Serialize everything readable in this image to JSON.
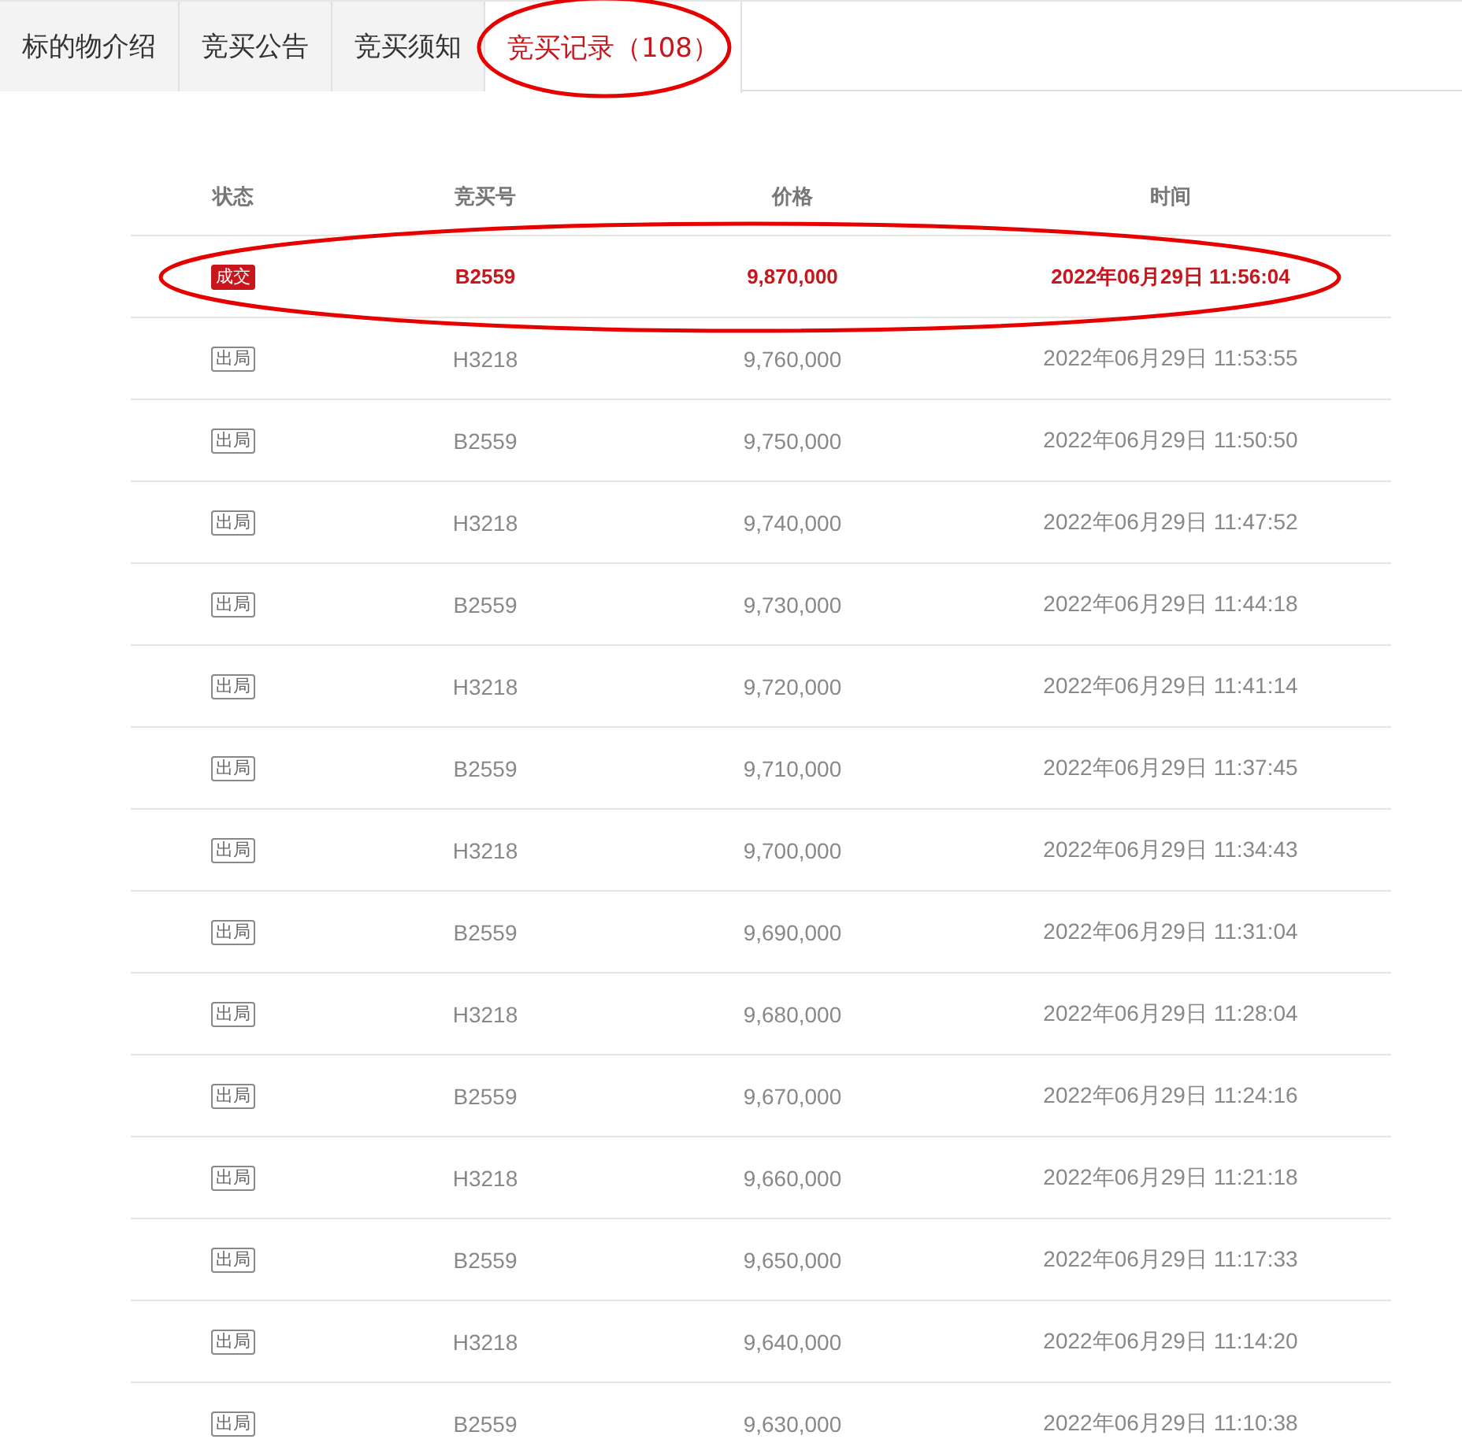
{
  "tabs": [
    {
      "label": "标的物介绍",
      "selected": false,
      "circled": false
    },
    {
      "label": "竞买公告",
      "selected": false,
      "circled": false
    },
    {
      "label": "竞买须知",
      "selected": false,
      "circled": false
    },
    {
      "label": "竞买记录（108）",
      "selected": true,
      "circled": true
    }
  ],
  "table": {
    "columns": [
      "状态",
      "竞买号",
      "价格",
      "时间"
    ],
    "rows": [
      {
        "status": "成交",
        "won": true,
        "circled": true,
        "bidder": "B2559",
        "price": "9,870,000",
        "time": "2022年06月29日 11:56:04"
      },
      {
        "status": "出局",
        "won": false,
        "circled": false,
        "bidder": "H3218",
        "price": "9,760,000",
        "time": "2022年06月29日 11:53:55"
      },
      {
        "status": "出局",
        "won": false,
        "circled": false,
        "bidder": "B2559",
        "price": "9,750,000",
        "time": "2022年06月29日 11:50:50"
      },
      {
        "status": "出局",
        "won": false,
        "circled": false,
        "bidder": "H3218",
        "price": "9,740,000",
        "time": "2022年06月29日 11:47:52"
      },
      {
        "status": "出局",
        "won": false,
        "circled": false,
        "bidder": "B2559",
        "price": "9,730,000",
        "time": "2022年06月29日 11:44:18"
      },
      {
        "status": "出局",
        "won": false,
        "circled": false,
        "bidder": "H3218",
        "price": "9,720,000",
        "time": "2022年06月29日 11:41:14"
      },
      {
        "status": "出局",
        "won": false,
        "circled": false,
        "bidder": "B2559",
        "price": "9,710,000",
        "time": "2022年06月29日 11:37:45"
      },
      {
        "status": "出局",
        "won": false,
        "circled": false,
        "bidder": "H3218",
        "price": "9,700,000",
        "time": "2022年06月29日 11:34:43"
      },
      {
        "status": "出局",
        "won": false,
        "circled": false,
        "bidder": "B2559",
        "price": "9,690,000",
        "time": "2022年06月29日 11:31:04"
      },
      {
        "status": "出局",
        "won": false,
        "circled": false,
        "bidder": "H3218",
        "price": "9,680,000",
        "time": "2022年06月29日 11:28:04"
      },
      {
        "status": "出局",
        "won": false,
        "circled": false,
        "bidder": "B2559",
        "price": "9,670,000",
        "time": "2022年06月29日 11:24:16"
      },
      {
        "status": "出局",
        "won": false,
        "circled": false,
        "bidder": "H3218",
        "price": "9,660,000",
        "time": "2022年06月29日 11:21:18"
      },
      {
        "status": "出局",
        "won": false,
        "circled": false,
        "bidder": "B2559",
        "price": "9,650,000",
        "time": "2022年06月29日 11:17:33"
      },
      {
        "status": "出局",
        "won": false,
        "circled": false,
        "bidder": "H3218",
        "price": "9,640,000",
        "time": "2022年06月29日 11:14:20"
      },
      {
        "status": "出局",
        "won": false,
        "circled": false,
        "bidder": "B2559",
        "price": "9,630,000",
        "time": "2022年06月29日 11:10:38"
      }
    ]
  }
}
